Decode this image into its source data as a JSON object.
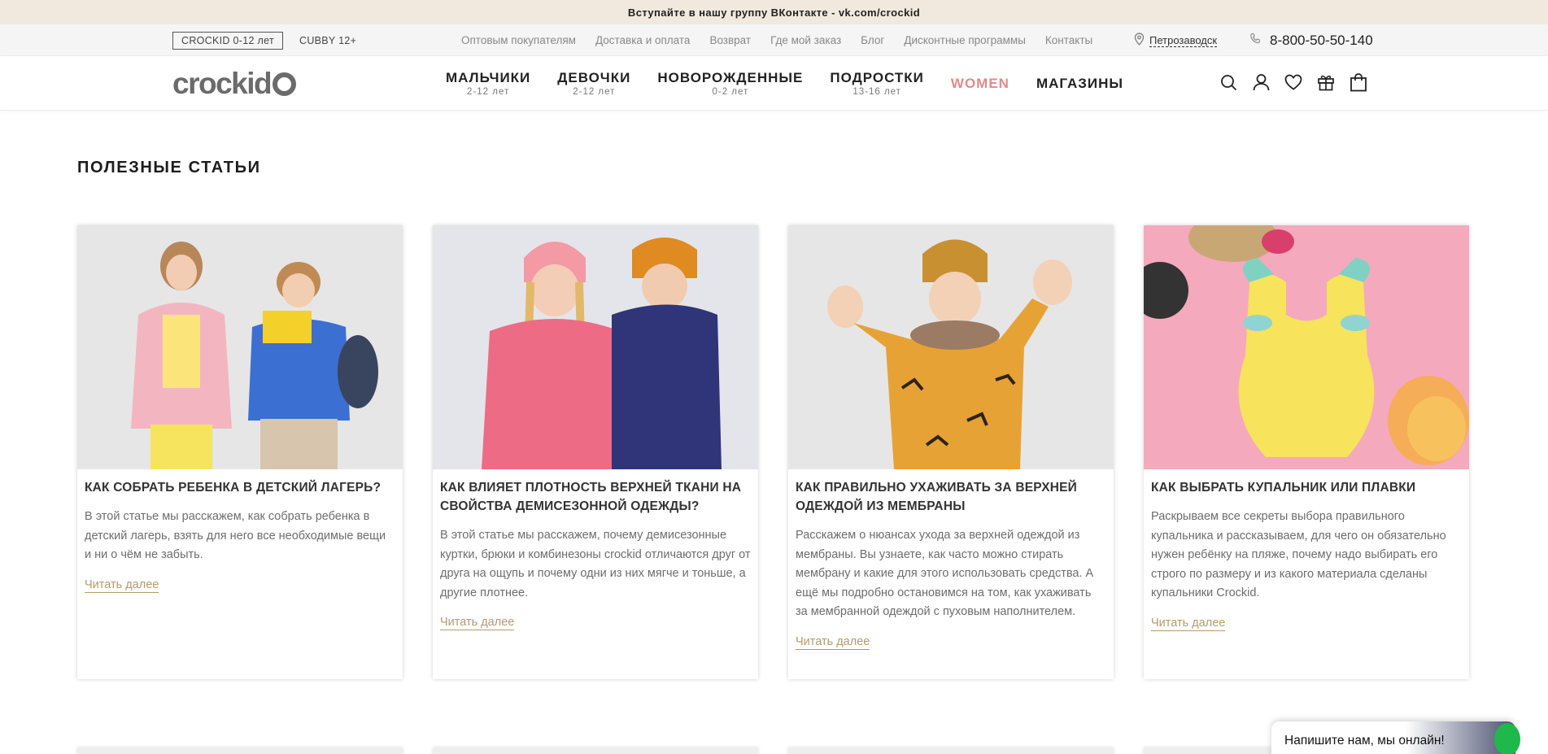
{
  "promo": {
    "text": "Вступайте в нашу группу ВКонтакте - vk.com/crockid"
  },
  "utility": {
    "age_tabs": [
      "CROCKID 0-12 лет",
      "CUBBY 12+"
    ],
    "links": [
      "Оптовым покупателям",
      "Доставка и оплата",
      "Возврат",
      "Где мой заказ",
      "Блог",
      "Дисконтные программы",
      "Контакты"
    ],
    "city": "Петрозаводск",
    "phone": "8-800-50-50-140"
  },
  "header": {
    "logo": "crockid",
    "nav": [
      {
        "label": "МАЛЬЧИКИ",
        "sub": "2-12 лет"
      },
      {
        "label": "ДЕВОЧКИ",
        "sub": "2-12 лет"
      },
      {
        "label": "НОВОРОЖДЕННЫЕ",
        "sub": "0-2 лет"
      },
      {
        "label": "ПОДРОСТКИ",
        "sub": "13-16 лет"
      },
      {
        "label": "WOMEN",
        "sub": ""
      },
      {
        "label": "МАГАЗИНЫ",
        "sub": ""
      }
    ],
    "icons": [
      "search-icon",
      "user-icon",
      "heart-icon",
      "gift-icon",
      "cart-icon"
    ],
    "accent_color": "#e08a8a"
  },
  "section": {
    "title": "ПОЛЕЗНЫЕ СТАТЬИ"
  },
  "articles": [
    {
      "title": "КАК СОБРАТЬ РЕБЕНКА В ДЕТСКИЙ ЛАГЕРЬ?",
      "text": "В этой статье мы расскажем, как собрать ребенка в детский лагерь, взять для него все необходимые вещи и ни о чём не забыть.",
      "more": "Читать далее"
    },
    {
      "title": "КАК ВЛИЯЕТ ПЛОТНОСТЬ ВЕРХНЕЙ ТКАНИ НА СВОЙСТВА ДЕМИСЕЗОННОЙ ОДЕЖДЫ?",
      "text": "В этой статье мы расскажем, почему демисезонные куртки, брюки и комбинезоны crockid отличаются друг от друга на ощупь и почему одни из них мягче и тоньше, а другие плотнее.",
      "more": "Читать далее"
    },
    {
      "title": "КАК ПРАВИЛЬНО УХАЖИВАТЬ ЗА ВЕРХНЕЙ ОДЕЖДОЙ ИЗ МЕМБРАНЫ",
      "text": "Расскажем о нюансах ухода за верхней одеждой из мембраны. Вы узнаете, как часто можно стирать мембрану и какие для этого использовать средства. А ещё мы подробно остановимся на том, как ухаживать за мембранной одеждой с пуховым наполнителем.",
      "more": "Читать далее"
    },
    {
      "title": "КАК ВЫБРАТЬ КУПАЛЬНИК ИЛИ ПЛАВКИ",
      "text": "Раскрываем все секреты выбора правильного купальника и рассказываем, для чего он обязательно нужен ребёнку на пляже, почему надо выбирать его строго по размеру и из какого материала сделаны купальники Crockid.",
      "more": "Читать далее"
    }
  ],
  "chat": {
    "text": "Напишите нам, мы онлайн!"
  }
}
